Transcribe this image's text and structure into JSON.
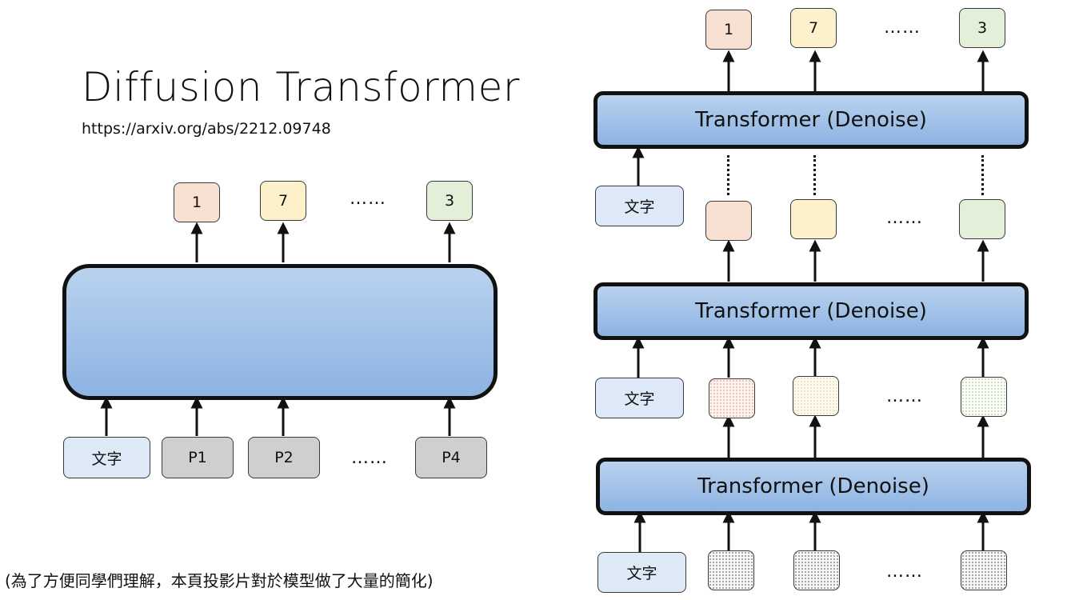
{
  "title": "Diffusion Transformer",
  "link": "https://arxiv.org/abs/2212.09748",
  "footnote": "(為了方便同學們理解，本頁投影片對於模型做了大量的簡化)",
  "left": {
    "outputs": [
      "1",
      "7",
      "3"
    ],
    "inputs": [
      "文字",
      "P1",
      "P2",
      "P4"
    ],
    "ellipsis": "……"
  },
  "right": {
    "block_label": "Transformer (Denoise)",
    "outputs": [
      "1",
      "7",
      "3"
    ],
    "text_label": "文字",
    "ellipsis": "……"
  },
  "colors": {
    "token_pink": "#f8e0d3",
    "token_yellow": "#fdf1cb",
    "token_green": "#e3efd9",
    "text_box": "#dde9f6",
    "patch_gray": "#cfcfcf",
    "transformer_blue": "#9fc0e8"
  }
}
